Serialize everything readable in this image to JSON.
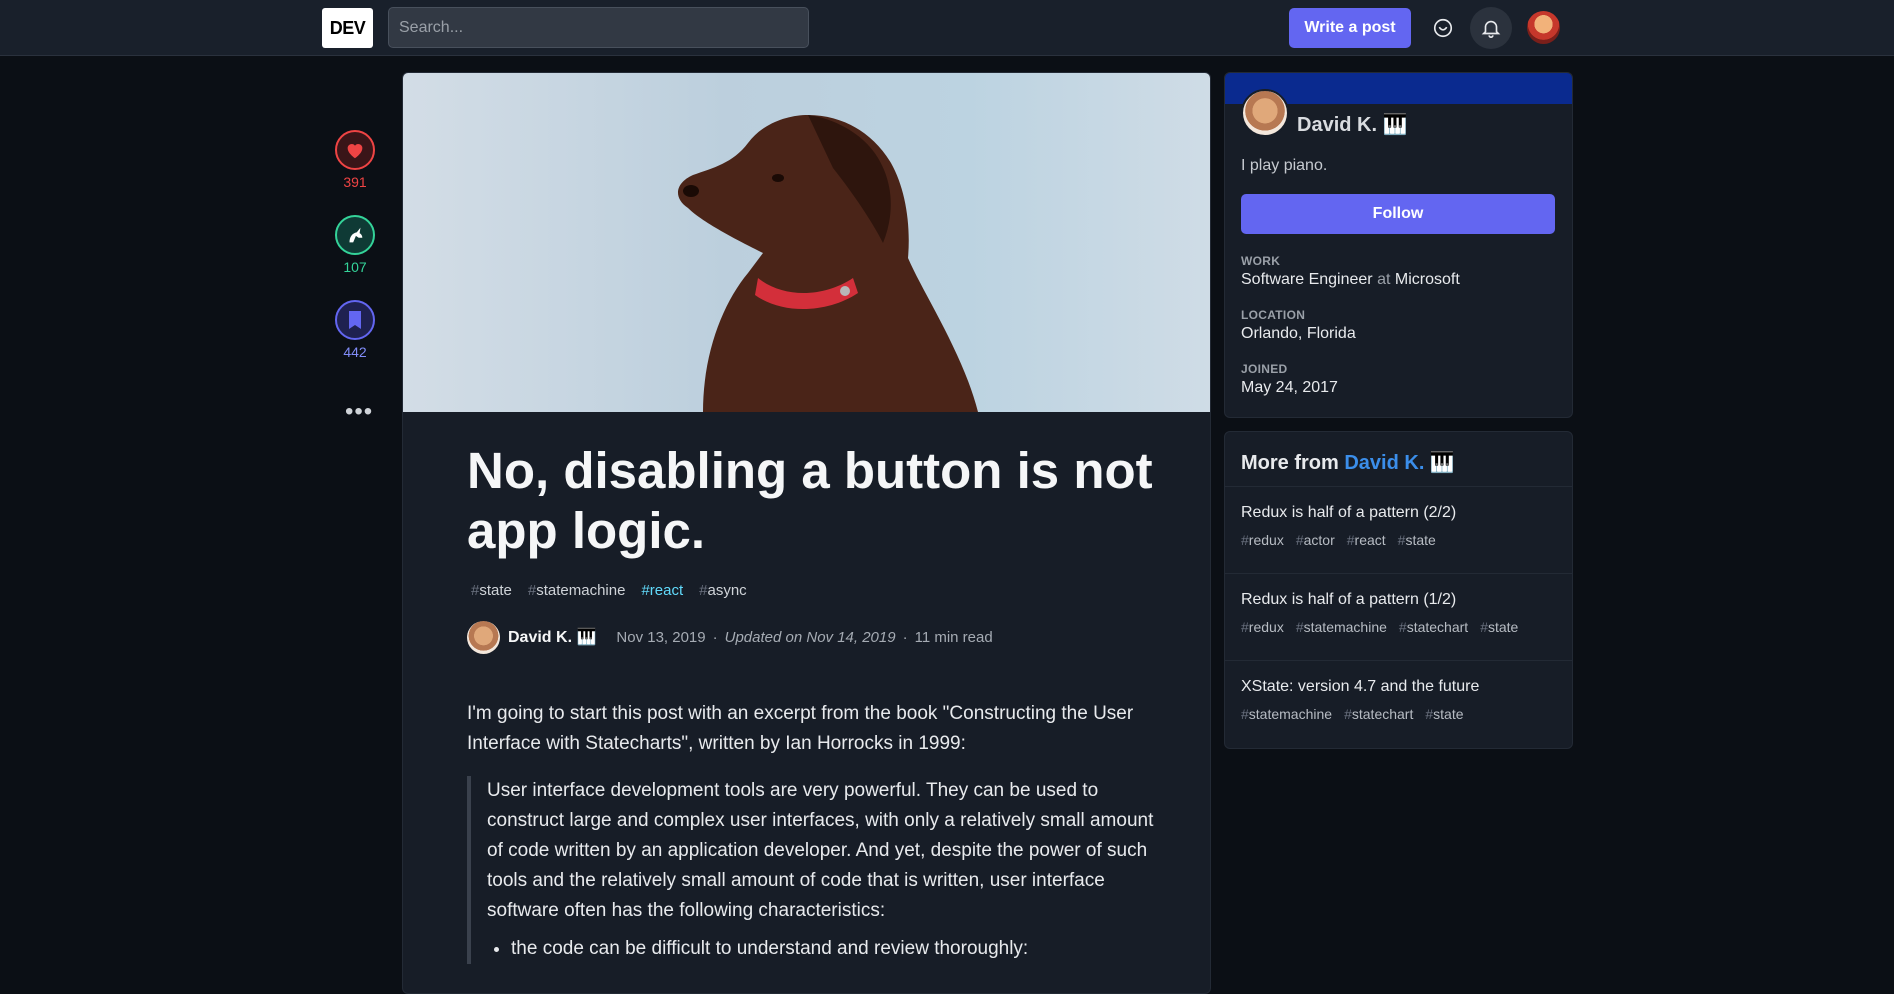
{
  "header": {
    "logo": "DEV",
    "search_placeholder": "Search...",
    "write_button": "Write a post"
  },
  "reactions": {
    "likes": "391",
    "unicorns": "107",
    "bookmarks": "442",
    "more": "•••",
    "colors": {
      "likes": "#ef4444",
      "unicorns": "#34d399",
      "bookmarks": "#6366f1"
    }
  },
  "article": {
    "title": "No, disabling a button is not app logic.",
    "tags": [
      {
        "hash": "#",
        "name": "state"
      },
      {
        "hash": "#",
        "name": "statemachine"
      },
      {
        "hash": "#",
        "name": "react"
      },
      {
        "hash": "#",
        "name": "async"
      }
    ],
    "author": "David K. 🎹",
    "published": "Nov 13, 2019",
    "updated": "Updated on Nov 14, 2019",
    "read_time": "11 min read",
    "dot": "·",
    "intro": "I'm going to start this post with an excerpt from the book \"Constructing the User Interface with Statecharts\", written by Ian Horrocks in 1999:",
    "quote": "User interface development tools are very powerful. They can be used to construct large and complex user interfaces, with only a relatively small amount of code written by an application developer. And yet, despite the power of such tools and the relatively small amount of code that is written, user interface software often has the following characteristics:",
    "quote_bullets": [
      "the code can be difficult to understand and review thoroughly:"
    ]
  },
  "profile": {
    "name": "David K. 🎹",
    "bio": "I play piano.",
    "follow_button": "Follow",
    "work_label": "WORK",
    "work_title": "Software Engineer",
    "work_at": "at",
    "work_company": "Microsoft",
    "location_label": "LOCATION",
    "location": "Orlando, Florida",
    "joined_label": "JOINED",
    "joined": "May 24, 2017"
  },
  "more_from": {
    "prefix": "More from",
    "author_link": "David K. 🎹",
    "items": [
      {
        "title": "Redux is half of a pattern (2/2)",
        "tags": [
          "redux",
          "actor",
          "react",
          "state"
        ]
      },
      {
        "title": "Redux is half of a pattern (1/2)",
        "tags": [
          "redux",
          "statemachine",
          "statechart",
          "state"
        ]
      },
      {
        "title": "XState: version 4.7 and the future",
        "tags": [
          "statemachine",
          "statechart",
          "state"
        ]
      }
    ]
  }
}
